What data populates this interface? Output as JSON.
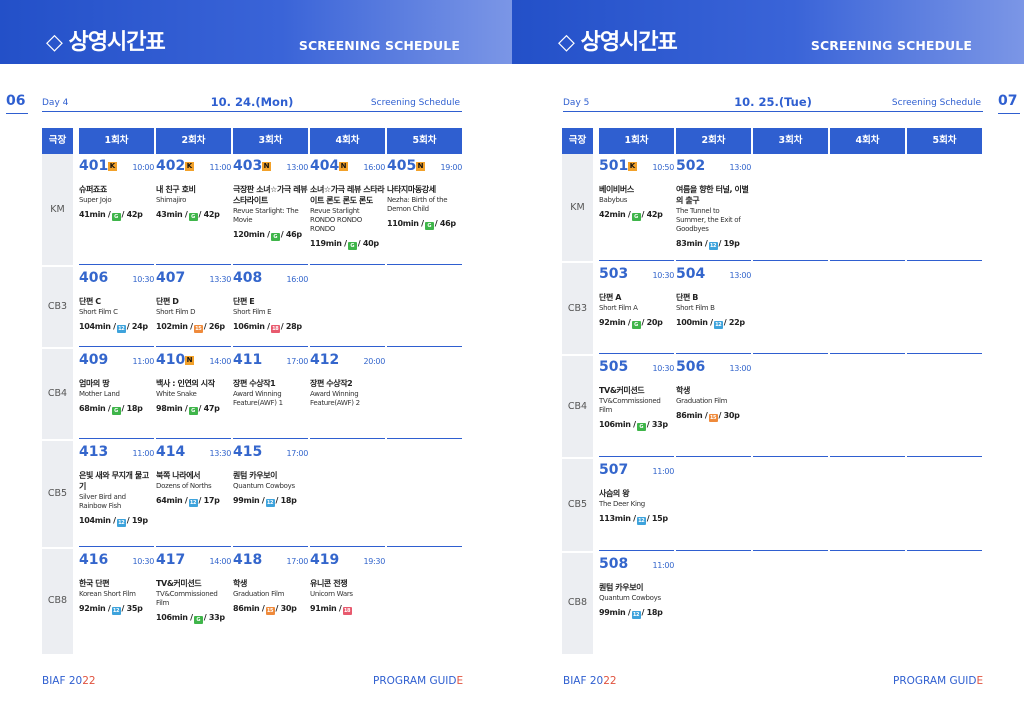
{
  "header": {
    "title": "◇ 상영시간표",
    "subtitle": "SCREENING SCHEDULE"
  },
  "columns": [
    "극장",
    "1회차",
    "2회차",
    "3회차",
    "4회차",
    "5회차"
  ],
  "footer": {
    "left_main": "BIAF 20",
    "left_accent": "22",
    "right_main": "PROGRAM GUID",
    "right_accent": "E"
  },
  "colors": {
    "accent": "#2f5fd0",
    "badge": "#f2a12a",
    "rating_green": "#3fb54a",
    "rating_blue": "#3ea3dc",
    "rating_orange": "#ef8a3b",
    "rating_red": "#e85a6e"
  },
  "left": {
    "page_number": "06",
    "day": "Day 4",
    "date": "10. 24.(Mon)",
    "label": "Screening Schedule",
    "rows": [
      {
        "venue": "KM",
        "cells": [
          {
            "code": "401",
            "badge": "K",
            "time": "10:00",
            "ko": "슈퍼죠죠",
            "en": "Super Jojo",
            "min": "41min /",
            "rating": "G",
            "rtype": "g",
            "pages": "/ 42p"
          },
          {
            "code": "402",
            "badge": "K",
            "time": "11:00",
            "ko": "내 친구 호비",
            "en": "Shimajiro",
            "min": "43min /",
            "rating": "G",
            "rtype": "g",
            "pages": "/ 42p"
          },
          {
            "code": "403",
            "badge": "N",
            "time": "13:00",
            "ko": "극장판 소녀☆가극 레뷰 스타라이트",
            "en": "Revue Starlight: The Movie",
            "min": "120min /",
            "rating": "G",
            "rtype": "g",
            "pages": "/ 46p"
          },
          {
            "code": "404",
            "badge": "N",
            "time": "16:00",
            "ko": "소녀☆가극 레뷰 스타라이트 론도 론도 론도",
            "en": "Revue Starlight RONDO RONDO RONDO",
            "min": "119min /",
            "rating": "G",
            "rtype": "g",
            "pages": "/ 40p"
          },
          {
            "code": "405",
            "badge": "N",
            "time": "19:00",
            "ko": "나타지마동강세",
            "en": "Nezha: Birth of the Demon Child",
            "min": "110min /",
            "rating": "G",
            "rtype": "g",
            "pages": "/ 46p"
          }
        ]
      },
      {
        "venue": "CB3",
        "cells": [
          {
            "code": "406",
            "time": "10:30",
            "ko": "단편 C",
            "en": "Short Film C",
            "min": "104min /",
            "rating": "12",
            "rtype": "b",
            "pages": "/ 24p"
          },
          {
            "code": "407",
            "time": "13:30",
            "ko": "단편 D",
            "en": "Short Film D",
            "min": "102min /",
            "rating": "15",
            "rtype": "o",
            "pages": "/ 26p"
          },
          {
            "code": "408",
            "time": "16:00",
            "ko": "단편 E",
            "en": "Short Film E",
            "min": "106min /",
            "rating": "18",
            "rtype": "r",
            "pages": "/ 28p"
          }
        ]
      },
      {
        "venue": "CB4",
        "cells": [
          {
            "code": "409",
            "time": "11:00",
            "ko": "엄마의 땅",
            "en": "Mother Land",
            "min": "68min /",
            "rating": "G",
            "rtype": "g",
            "pages": "/ 18p"
          },
          {
            "code": "410",
            "badge": "N",
            "time": "14:00",
            "ko": "백사 : 인연의 시작",
            "en": "White Snake",
            "min": "98min /",
            "rating": "G",
            "rtype": "g",
            "pages": "/ 47p"
          },
          {
            "code": "411",
            "time": "17:00",
            "ko": "장편 수상작1",
            "en": "Award Winning Feature(AWF) 1",
            "min": "",
            "rating": "",
            "rtype": "",
            "pages": ""
          },
          {
            "code": "412",
            "time": "20:00",
            "ko": "장편 수상작2",
            "en": "Award Winning Feature(AWF) 2",
            "min": "",
            "rating": "",
            "rtype": "",
            "pages": ""
          }
        ]
      },
      {
        "venue": "CB5",
        "cells": [
          {
            "code": "413",
            "time": "11:00",
            "ko": "은빛 새와 무지개 물고기",
            "en": "Silver Bird and Rainbow Fish",
            "min": "104min /",
            "rating": "12",
            "rtype": "b",
            "pages": "/ 19p"
          },
          {
            "code": "414",
            "time": "13:30",
            "ko": "북쪽 나라에서",
            "en": "Dozens of Norths",
            "min": "64min /",
            "rating": "12",
            "rtype": "b",
            "pages": "/ 17p"
          },
          {
            "code": "415",
            "time": "17:00",
            "ko": "퀀텀 카우보이",
            "en": "Quantum Cowboys",
            "min": "99min /",
            "rating": "12",
            "rtype": "b",
            "pages": "/ 18p"
          }
        ]
      },
      {
        "venue": "CB8",
        "cells": [
          {
            "code": "416",
            "time": "10:30",
            "ko": "한국 단편",
            "en": "Korean Short Film",
            "min": "92min /",
            "rating": "12",
            "rtype": "b",
            "pages": "/ 35p"
          },
          {
            "code": "417",
            "time": "14:00",
            "ko": "TV&커미션드",
            "en": "TV&Commissioned Film",
            "min": "106min /",
            "rating": "G",
            "rtype": "g",
            "pages": "/ 33p"
          },
          {
            "code": "418",
            "time": "17:00",
            "ko": "학생",
            "en": "Graduation Film",
            "min": "86min /",
            "rating": "15",
            "rtype": "o",
            "pages": "/ 30p"
          },
          {
            "code": "419",
            "time": "19:30",
            "ko": "유니콘 전쟁",
            "en": "Unicorn Wars",
            "min": "91min /",
            "rating": "18",
            "rtype": "r",
            "pages": ""
          }
        ]
      }
    ]
  },
  "right": {
    "page_number": "07",
    "day": "Day 5",
    "date": "10. 25.(Tue)",
    "label": "Screening Schedule",
    "rows": [
      {
        "venue": "KM",
        "cells": [
          {
            "code": "501",
            "badge": "K",
            "time": "10:50",
            "ko": "베이비버스",
            "en": "Babybus",
            "min": "42min /",
            "rating": "G",
            "rtype": "g",
            "pages": "/ 42p"
          },
          {
            "code": "502",
            "time": "13:00",
            "ko": "여름을 향한 터널, 이별의 출구",
            "en": "The Tunnel to Summer, the Exit of Goodbyes",
            "min": "83min /",
            "rating": "12",
            "rtype": "b",
            "pages": "/ 19p"
          }
        ]
      },
      {
        "venue": "CB3",
        "cells": [
          {
            "code": "503",
            "time": "10:30",
            "ko": "단편 A",
            "en": "Short Film A",
            "min": "92min /",
            "rating": "G",
            "rtype": "g",
            "pages": "/ 20p"
          },
          {
            "code": "504",
            "time": "13:00",
            "ko": "단편 B",
            "en": "Short Film B",
            "min": "100min /",
            "rating": "12",
            "rtype": "b",
            "pages": "/ 22p"
          }
        ]
      },
      {
        "venue": "CB4",
        "cells": [
          {
            "code": "505",
            "time": "10:30",
            "ko": "TV&커미션드",
            "en": "TV&Commissioned Film",
            "min": "106min /",
            "rating": "G",
            "rtype": "g",
            "pages": "/ 33p"
          },
          {
            "code": "506",
            "time": "13:00",
            "ko": "학생",
            "en": "Graduation Film",
            "min": "86min /",
            "rating": "15",
            "rtype": "o",
            "pages": "/ 30p"
          }
        ]
      },
      {
        "venue": "CB5",
        "cells": [
          {
            "code": "507",
            "time": "11:00",
            "ko": "사슴의 왕",
            "en": "The Deer King",
            "min": "113min /",
            "rating": "12",
            "rtype": "b",
            "pages": "/ 15p"
          }
        ]
      },
      {
        "venue": "CB8",
        "cells": [
          {
            "code": "508",
            "time": "11:00",
            "ko": "퀀텀 카우보이",
            "en": "Quantum Cowboys",
            "min": "99min /",
            "rating": "12",
            "rtype": "b",
            "pages": "/ 18p"
          }
        ]
      }
    ]
  }
}
